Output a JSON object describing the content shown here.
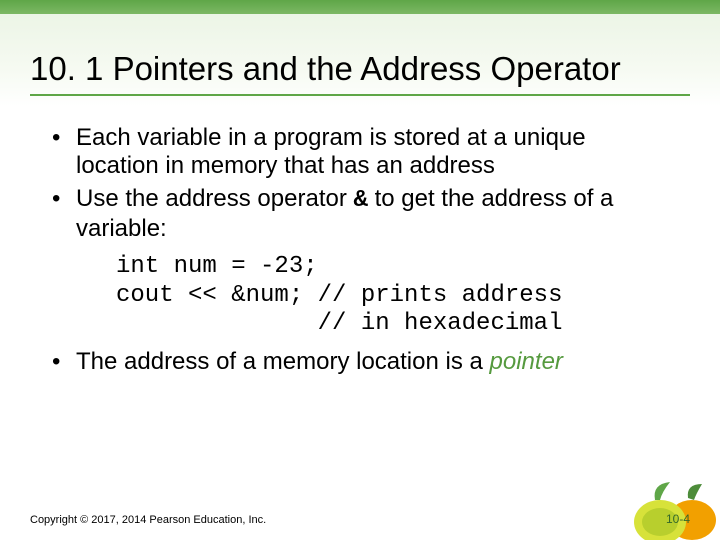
{
  "title": "10. 1  Pointers and the Address Operator",
  "bullets": {
    "b1": "Each  variable in a program is stored at a unique location in memory that has an address",
    "b2a": "Use the address operator ",
    "b2_amp": "&",
    "b2b": " to get the address of a variable:",
    "b3a": "The address of a memory location is a ",
    "b3_pointer": "pointer"
  },
  "code": "int num = -23;\ncout << &num; // prints address\n              // in hexadecimal",
  "footer": {
    "copyright": "Copyright © 2017, 2014 Pearson Education, Inc.",
    "page": "10-4"
  }
}
